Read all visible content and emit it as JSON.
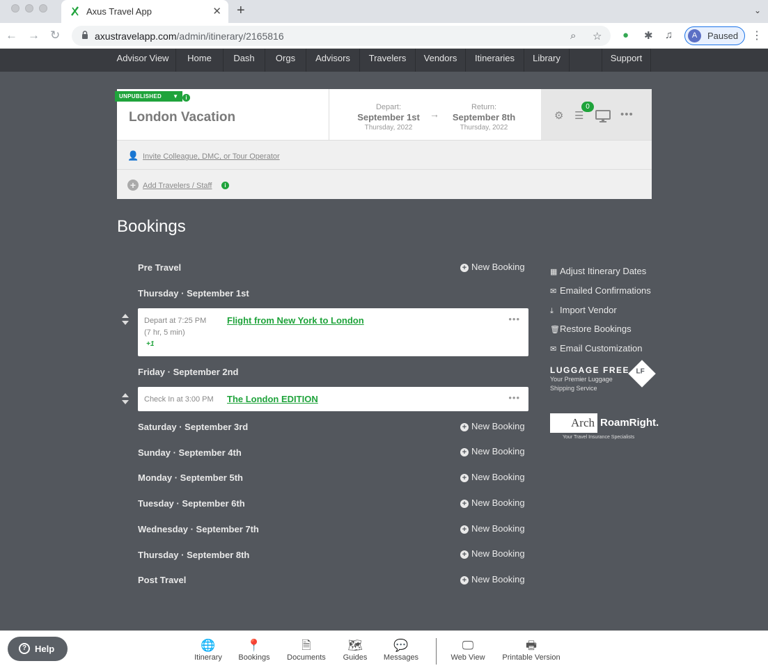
{
  "browser": {
    "tab_title": "Axus Travel App",
    "url_host": "axustravelapp.com",
    "url_path": "/admin/itinerary/2165816",
    "profile_initial": "A",
    "profile_status": "Paused"
  },
  "nav": {
    "items": [
      "Advisor View",
      "Home",
      "Dash",
      "Orgs",
      "Advisors",
      "Travelers",
      "Vendors",
      "Itineraries",
      "Library",
      "Support"
    ]
  },
  "itinerary": {
    "status": "UNPUBLISHED",
    "title": "London Vacation",
    "depart_label": "Depart:",
    "depart_date": "September 1st",
    "depart_sub": "Thursday, 2022",
    "return_label": "Return:",
    "return_date": "September 8th",
    "return_sub": "Thursday, 2022",
    "checklist_count": "0",
    "invite_link": "Invite Colleague, DMC, or Tour Operator",
    "add_travelers_link": "Add Travelers / Staff"
  },
  "bookings": {
    "title": "Bookings",
    "new_booking_label": "New Booking",
    "days": [
      {
        "label": "Pre Travel",
        "has_new": true
      },
      {
        "label": "Thursday · September 1st",
        "has_new": false
      },
      {
        "label": "Friday · September 2nd",
        "has_new": false
      },
      {
        "label": "Saturday · September 3rd",
        "has_new": true
      },
      {
        "label": "Sunday · September 4th",
        "has_new": true
      },
      {
        "label": "Monday · September 5th",
        "has_new": true
      },
      {
        "label": "Tuesday · September 6th",
        "has_new": true
      },
      {
        "label": "Wednesday · September 7th",
        "has_new": true
      },
      {
        "label": "Thursday · September 8th",
        "has_new": true
      },
      {
        "label": "Post Travel",
        "has_new": true
      }
    ],
    "items": [
      {
        "meta": "Depart at 7:25 PM",
        "meta2": "(7 hr, 5 min)",
        "extra": "+1",
        "title": "Flight from New York to London"
      },
      {
        "meta": "Check In at 3:00 PM",
        "title": "The London EDITION"
      }
    ]
  },
  "sidebar": {
    "links": [
      "Adjust Itinerary Dates",
      "Emailed Confirmations",
      "Import Vendor",
      "Restore Bookings",
      "Email Customization"
    ],
    "lf_title": "LUGGAGE FREE",
    "lf_sub1": "Your Premier Luggage",
    "lf_sub2": "Shipping Service",
    "lf_mark": "LF",
    "arch_left": "Arch",
    "arch_right": "RoamRight.",
    "arch_sub": "Your Travel Insurance Specialists"
  },
  "toolbar": {
    "help": "Help",
    "items": [
      "Itinerary",
      "Bookings",
      "Documents",
      "Guides",
      "Messages",
      "Web View",
      "Printable Version"
    ]
  },
  "colors": {
    "accent": "#1fa33b",
    "page_bg": "#53575d",
    "nav_bg": "#393b40"
  }
}
